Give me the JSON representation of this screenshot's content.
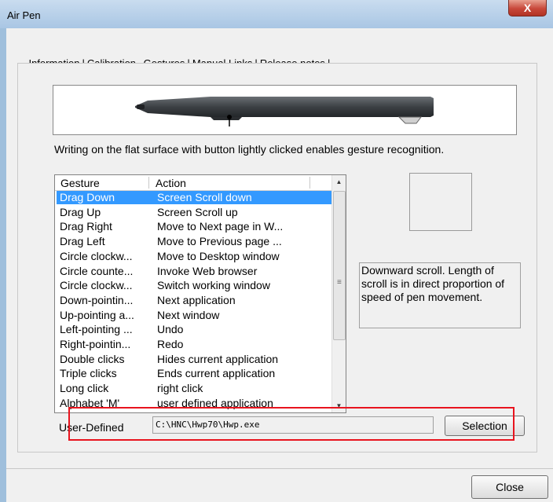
{
  "window": {
    "title": "Air Pen",
    "close_glyph": "X"
  },
  "tabs": [
    "Information",
    "Calibration",
    "Gestures",
    "Manual Links",
    "Release notes"
  ],
  "active_tab": "Gestures",
  "description": "Writing on the flat surface with button lightly clicked enables gesture recognition.",
  "list": {
    "headers": {
      "gesture": "Gesture",
      "action": "Action"
    },
    "rows": [
      {
        "gesture": "Drag Down",
        "action": "Screen Scroll down",
        "selected": true
      },
      {
        "gesture": "Drag Up",
        "action": "Screen Scroll up"
      },
      {
        "gesture": "Drag Right",
        "action": "Move to Next page in W..."
      },
      {
        "gesture": "Drag Left",
        "action": "Move to Previous page ..."
      },
      {
        "gesture": "Circle clockw...",
        "action": "Move to Desktop window"
      },
      {
        "gesture": "Circle counte...",
        "action": "Invoke Web browser"
      },
      {
        "gesture": "Circle clockw...",
        "action": "Switch working window"
      },
      {
        "gesture": "Down-pointin...",
        "action": "Next application"
      },
      {
        "gesture": "Up-pointing a...",
        "action": "Next window"
      },
      {
        "gesture": "Left-pointing ...",
        "action": "Undo"
      },
      {
        "gesture": "Right-pointin...",
        "action": "Redo"
      },
      {
        "gesture": "Double clicks",
        "action": "Hides current application"
      },
      {
        "gesture": "Triple clicks",
        "action": "Ends current application"
      },
      {
        "gesture": "Long click",
        "action": "right click"
      },
      {
        "gesture": "Alphabet 'M'",
        "action": "user defined application"
      }
    ]
  },
  "help_text": "Downward scroll. Length of scroll is in direct proportion of speed of pen movement.",
  "user_defined": {
    "label": "User-Defined",
    "path": "C:\\HNC\\Hwp70\\Hwp.exe",
    "button": "Selection"
  },
  "close_button": "Close",
  "colors": {
    "selection": "#3399ff",
    "highlight_box": "#e8141e"
  }
}
